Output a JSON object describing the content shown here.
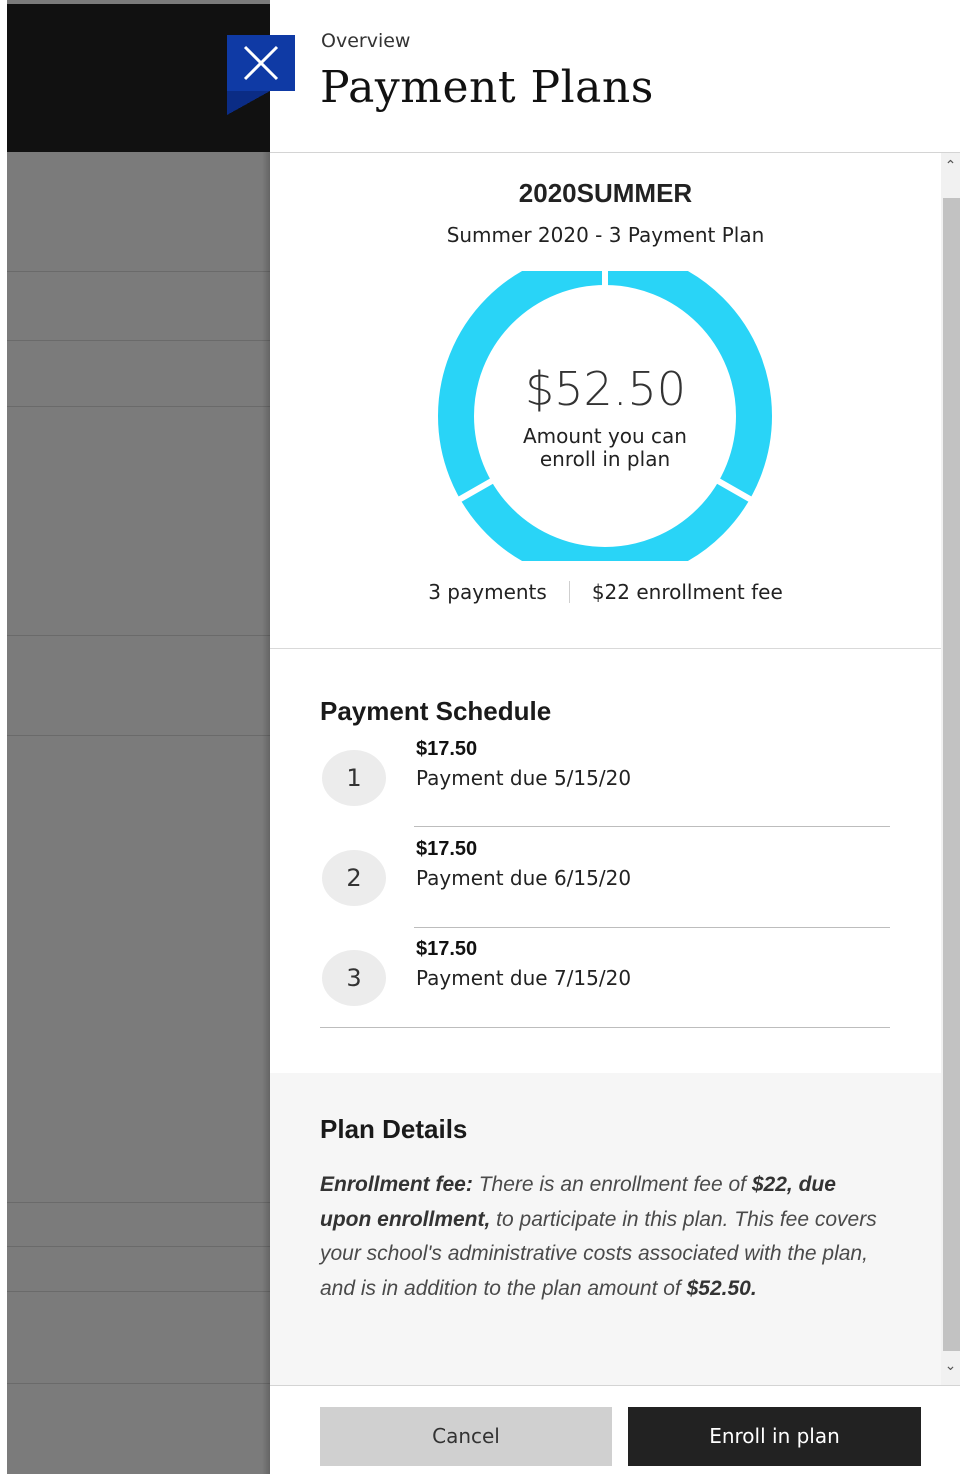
{
  "header": {
    "overview_label": "Overview",
    "title": "Payment Plans",
    "close_icon": "close-icon"
  },
  "plan": {
    "code": "2020SUMMER",
    "name": "Summer 2020 - 3 Payment Plan",
    "amount": "$52.50",
    "amount_label": "Amount you can enroll in plan",
    "payments_count": "3 payments",
    "enrollment_fee": "$22 enrollment fee",
    "donut_color": "#29d4f7",
    "donut_segments": 3
  },
  "schedule": {
    "title": "Payment Schedule",
    "items": [
      {
        "number": "1",
        "amount": "$17.50",
        "due": "Payment due 5/15/20"
      },
      {
        "number": "2",
        "amount": "$17.50",
        "due": "Payment due 6/15/20"
      },
      {
        "number": "3",
        "amount": "$17.50",
        "due": "Payment due 7/15/20"
      }
    ]
  },
  "details": {
    "title": "Plan Details",
    "fee_label": "Enrollment fee:",
    "text_1": "There is an enrollment fee of",
    "fee_bold": "$22, due upon enrollment,",
    "text_2": "to participate in this plan. This fee covers your school's administrative costs associated with the plan, and is in addition to the plan amount of",
    "amount_bold": "$52.50."
  },
  "footer": {
    "cancel_label": "Cancel",
    "enroll_label": "Enroll in plan"
  },
  "colors": {
    "accent": "#0f3aa5",
    "donut": "#29d4f7",
    "primary_button": "#222222",
    "secondary_button": "#d0d0d0"
  }
}
